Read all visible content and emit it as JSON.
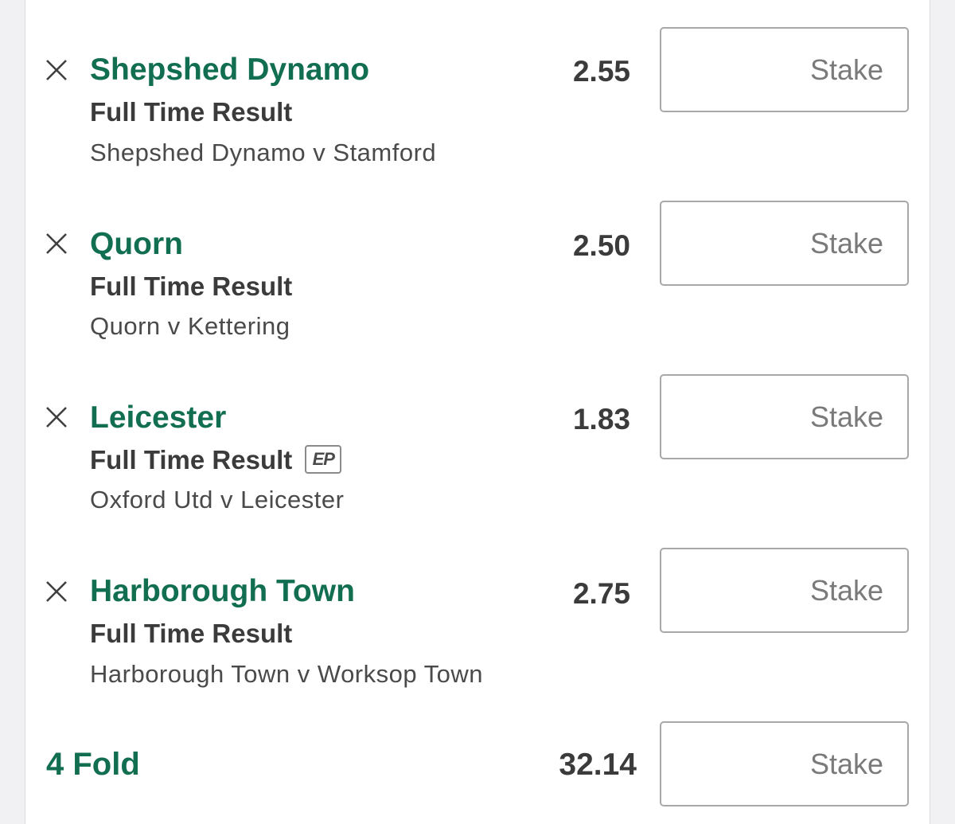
{
  "bet_slip": {
    "selections": [
      {
        "selection": "Shepshed Dynamo",
        "market": "Full Time Result",
        "fixture": "Shepshed Dynamo v Stamford",
        "odds": "2.55",
        "stake_placeholder": "Stake",
        "stake_value": ""
      },
      {
        "selection": "Quorn",
        "market": "Full Time Result",
        "fixture": "Quorn v Kettering",
        "odds": "2.50",
        "stake_placeholder": "Stake",
        "stake_value": ""
      },
      {
        "selection": "Leicester",
        "market": "Full Time Result",
        "badge": "EP",
        "fixture": "Oxford Utd v Leicester",
        "odds": "1.83",
        "stake_placeholder": "Stake",
        "stake_value": ""
      },
      {
        "selection": "Harborough Town",
        "market": "Full Time Result",
        "fixture": "Harborough Town v Worksop Town",
        "odds": "2.75",
        "stake_placeholder": "Stake",
        "stake_value": ""
      }
    ],
    "multiple": {
      "label": "4 Fold",
      "odds": "32.14",
      "stake_placeholder": "Stake",
      "stake_value": ""
    }
  },
  "icons": {
    "remove": "close-icon"
  },
  "colors": {
    "selection_green": "#126e51",
    "text_dark": "#3b3b3b",
    "text_muted": "#4a4a4a",
    "input_border": "#a8a8a8",
    "page_background": "#f1f1f3"
  }
}
